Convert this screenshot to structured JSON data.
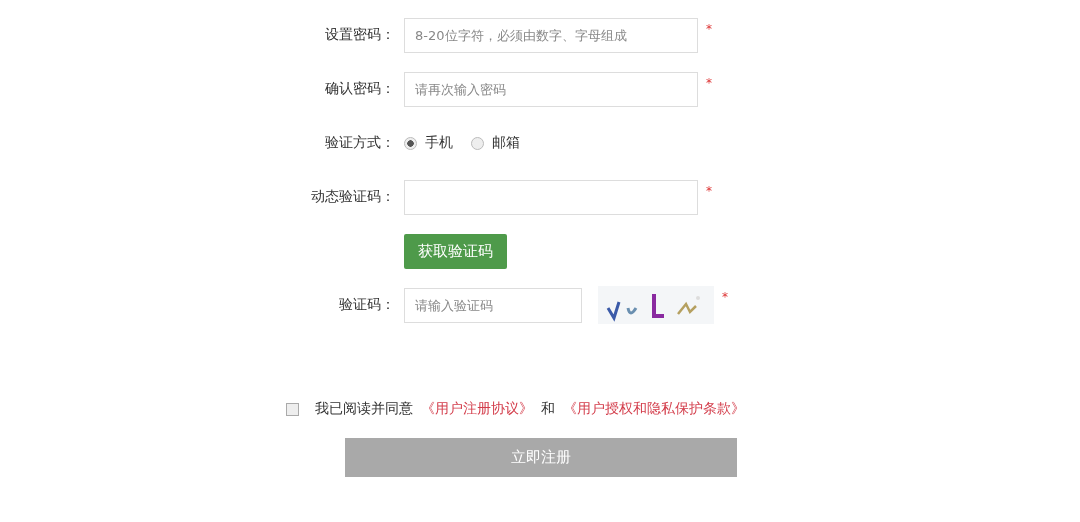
{
  "fields": [
    {
      "kind": "input",
      "label": "设置密码：",
      "placeholder": "8-20位字符，必须由数字、字母组成",
      "mark": "*"
    },
    {
      "kind": "input",
      "label": "确认密码：",
      "placeholder": "请再次输入密码",
      "mark": "*"
    },
    {
      "kind": "radio",
      "label": "验证方式：",
      "options": [
        {
          "label": "手机",
          "selected": true
        },
        {
          "label": "邮箱",
          "selected": false
        }
      ]
    },
    {
      "kind": "input",
      "label": "动态验证码：",
      "mark": "*"
    },
    {
      "kind": "button",
      "label": "获取验证码"
    },
    {
      "kind": "captcha",
      "label": "验证码：",
      "placeholder": "请输入验证码",
      "mark": "*"
    }
  ],
  "agreement": {
    "checked": false,
    "text": "我已阅读并同意",
    "links": [
      "《用户注册协议》",
      "《用户授权和隐私保护条款》"
    ],
    "joiner": "和"
  },
  "submit": {
    "label": "立即注册",
    "disabled": true
  }
}
